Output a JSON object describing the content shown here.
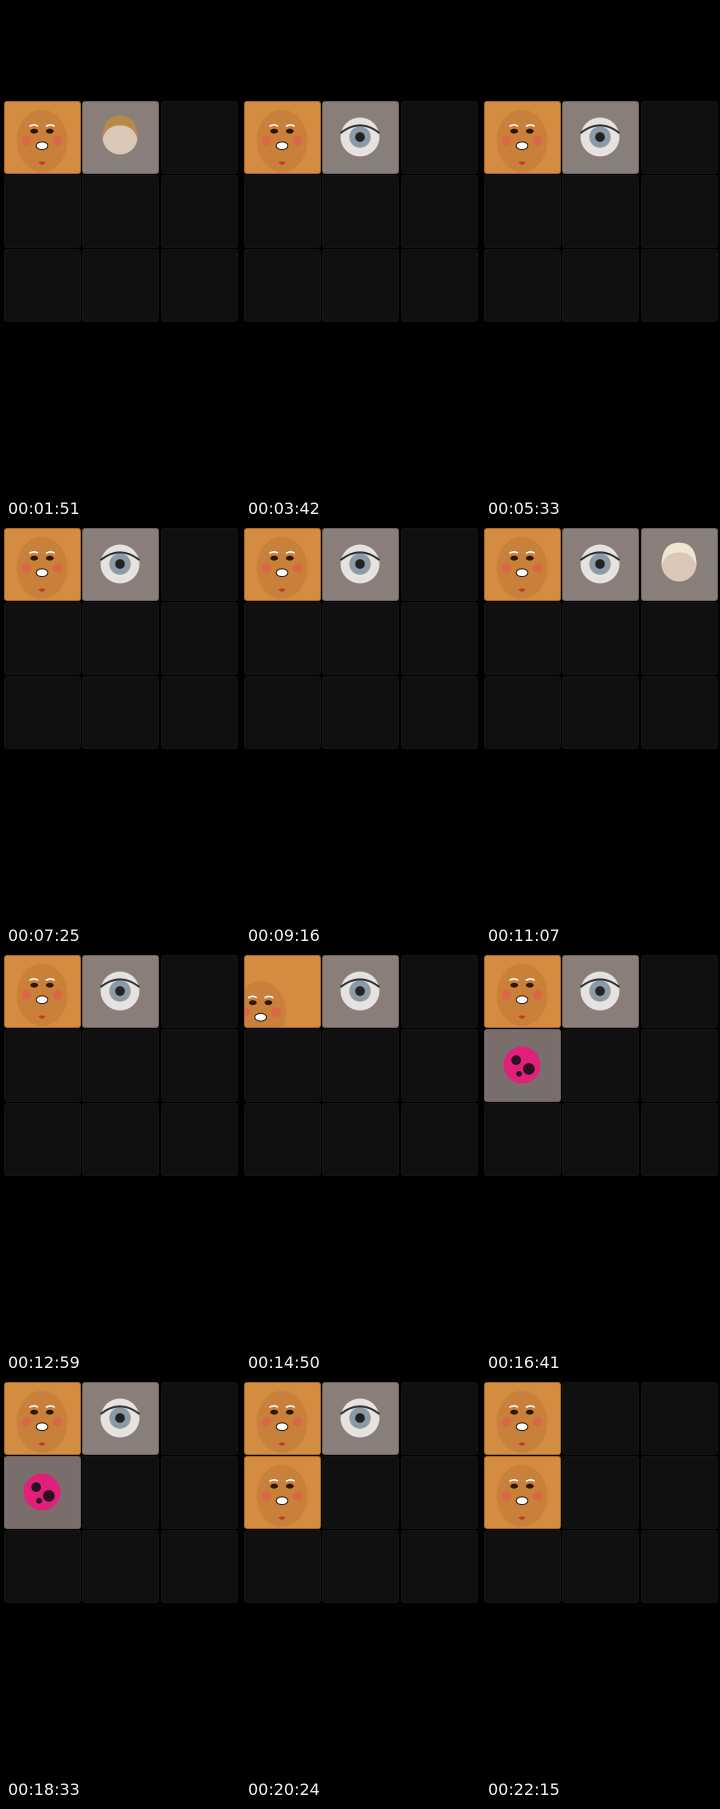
{
  "contact_sheet": {
    "frames": [
      {
        "timestamp": "00:01:51",
        "tiles": [
          [
            "ginger",
            "face-woman"
          ],
          [
            "empty"
          ],
          [
            "empty"
          ]
        ]
      },
      {
        "timestamp": "00:03:42",
        "tiles": [
          [
            "ginger",
            "eye"
          ],
          [
            "empty"
          ],
          [
            "empty"
          ]
        ]
      },
      {
        "timestamp": "00:05:33",
        "tiles": [
          [
            "ginger",
            "eye"
          ],
          [
            "empty"
          ],
          [
            "empty"
          ]
        ]
      },
      {
        "timestamp": "00:07:25",
        "tiles": [
          [
            "ginger",
            "eye"
          ],
          [
            "empty"
          ],
          [
            "empty"
          ]
        ]
      },
      {
        "timestamp": "00:09:16",
        "tiles": [
          [
            "ginger",
            "eye"
          ],
          [
            "empty"
          ],
          [
            "empty"
          ]
        ]
      },
      {
        "timestamp": "00:11:07",
        "tiles": [
          [
            "ginger",
            "eye",
            "face-blonde"
          ],
          [
            "empty"
          ],
          [
            "empty"
          ]
        ]
      },
      {
        "timestamp": "00:12:59",
        "tiles": [
          [
            "ginger",
            "eye"
          ],
          [
            "empty"
          ],
          [
            "empty"
          ]
        ]
      },
      {
        "timestamp": "00:14:50",
        "tiles": [
          [
            "ginger-partial",
            "eye"
          ],
          [
            "empty"
          ],
          [
            "empty"
          ]
        ]
      },
      {
        "timestamp": "00:16:41",
        "tiles": [
          [
            "ginger",
            "eye"
          ],
          [
            "pink-blob"
          ],
          [
            "empty"
          ]
        ]
      },
      {
        "timestamp": "00:18:33",
        "tiles": [
          [
            "ginger",
            "eye"
          ],
          [
            "pink-blob"
          ],
          [
            "empty"
          ]
        ]
      },
      {
        "timestamp": "00:20:24",
        "tiles": [
          [
            "ginger",
            "eye"
          ],
          [
            "ginger"
          ],
          [
            "empty"
          ]
        ]
      },
      {
        "timestamp": "00:22:15",
        "tiles": [
          [
            "ginger"
          ],
          [
            "ginger"
          ],
          [
            "empty"
          ]
        ]
      }
    ],
    "colors": {
      "background": "#000000",
      "tile_empty": "#101010",
      "ginger": "#d38c40",
      "grey_tile": "#8a7e7a",
      "pink": "#e0207a",
      "timestamp_text": "#f2f2f2"
    }
  }
}
